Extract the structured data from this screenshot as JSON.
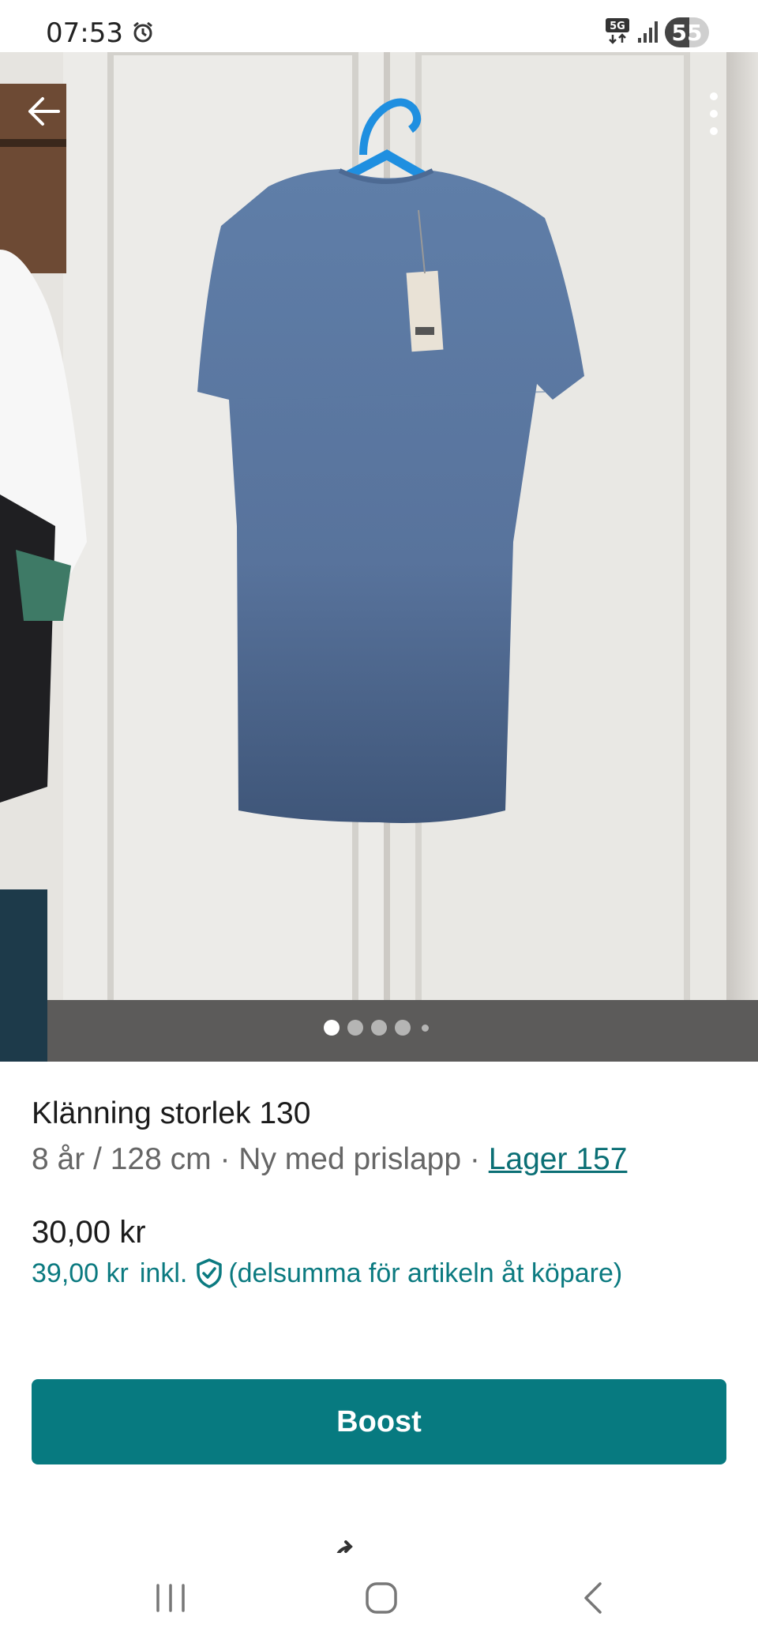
{
  "status_bar": {
    "time": "07:53",
    "network": "5G",
    "battery_level": "55",
    "battery_fraction": 0.55
  },
  "photo": {
    "page_count": 5,
    "active_page": 0
  },
  "listing": {
    "title": "Klänning storlek 130",
    "size": "8 år / 128 cm",
    "separator": " · ",
    "condition": "Ny med prislapp",
    "stock_link": "Lager 157",
    "price": "30,00 kr",
    "price_incl_amount": "39,00 kr",
    "price_incl_label": "inkl.",
    "price_incl_note": "(delsumma för artikeln åt köpare)"
  },
  "actions": {
    "boost_label": "Boost"
  },
  "icons": {
    "back": "arrow-left-icon",
    "more": "more-vertical-icon",
    "shield": "shield-check-icon",
    "nav_recents": "recents-icon",
    "nav_home": "home-icon",
    "nav_back": "back-chevron-icon"
  },
  "colors": {
    "accent": "#077a80",
    "link": "#0b6f75"
  }
}
